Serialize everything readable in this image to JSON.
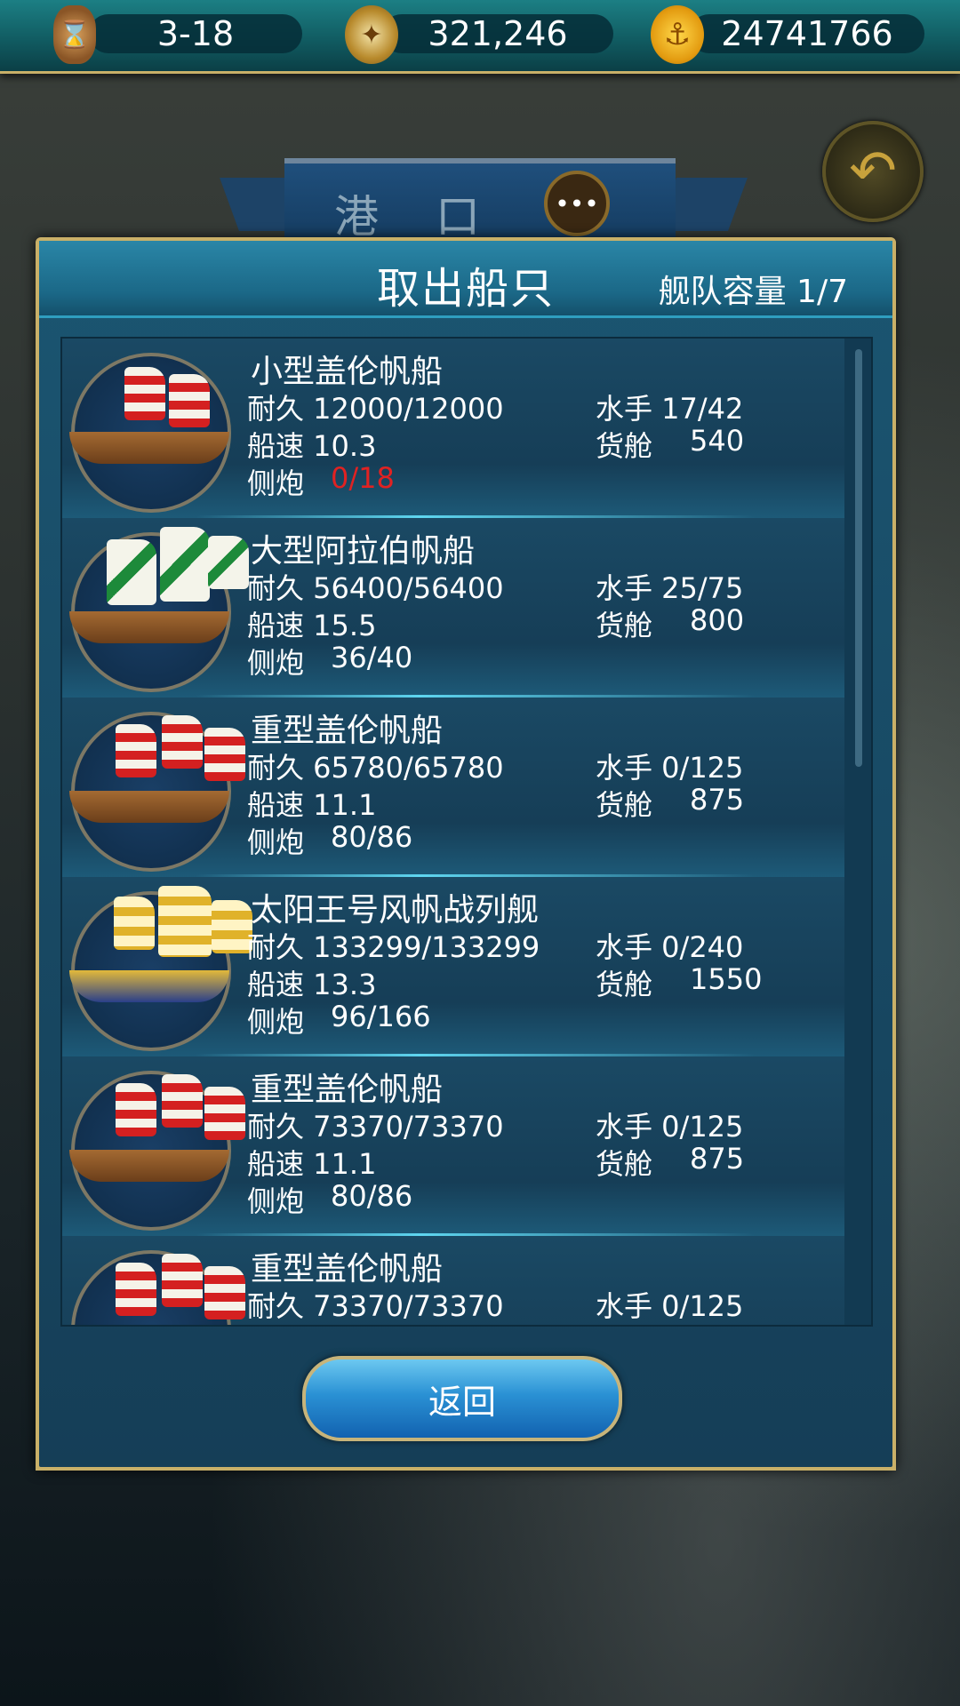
{
  "topbar": {
    "date": "3-18",
    "fame": "321,246",
    "gold": "24741766",
    "icons": [
      "hourglass-icon",
      "compass-icon",
      "gold-coin-icon"
    ]
  },
  "port_banner": {
    "title": "港 口"
  },
  "dialog": {
    "title": "取出船只",
    "fleet_capacity": "舰队容量 1/7",
    "return_label": "返回"
  },
  "ships": [
    {
      "name": "小型盖伦帆船",
      "durability": "耐久 12000/12000",
      "speed": "船速 10.3",
      "cannon_label": "侧炮",
      "cannon": "0/18",
      "crew": "水手 17/42",
      "cargo_label": "货舱",
      "cargo": "540",
      "sail": "red"
    },
    {
      "name": "大型阿拉伯帆船",
      "durability": "耐久 56400/56400",
      "speed": "船速 15.5",
      "cannon_label": "侧炮",
      "cannon": "36/40",
      "crew": "水手 25/75",
      "cargo_label": "货舱",
      "cargo": "800",
      "sail": "green"
    },
    {
      "name": "重型盖伦帆船",
      "durability": "耐久 65780/65780",
      "speed": "船速 11.1",
      "cannon_label": "侧炮",
      "cannon": "80/86",
      "crew": "水手 0/125",
      "cargo_label": "货舱",
      "cargo": "875",
      "sail": "red"
    },
    {
      "name": "太阳王号风帆战列舰",
      "durability": "耐久 133299/133299",
      "speed": "船速 13.3",
      "cannon_label": "侧炮",
      "cannon": "96/166",
      "crew": "水手 0/240",
      "cargo_label": "货舱",
      "cargo": "1550",
      "sail": "gold"
    },
    {
      "name": "重型盖伦帆船",
      "durability": "耐久 73370/73370",
      "speed": "船速 11.1",
      "cannon_label": "侧炮",
      "cannon": "80/86",
      "crew": "水手 0/125",
      "cargo_label": "货舱",
      "cargo": "875",
      "sail": "red"
    },
    {
      "name": "重型盖伦帆船",
      "durability": "耐久 73370/73370",
      "speed": "",
      "cannon_label": "",
      "cannon": "",
      "crew": "水手 0/125",
      "cargo_label": "",
      "cargo": "",
      "sail": "red"
    }
  ],
  "colors": {
    "accent_gold": "#c9b068",
    "warn_red": "#e02222",
    "panel_blue": "#153e57"
  }
}
